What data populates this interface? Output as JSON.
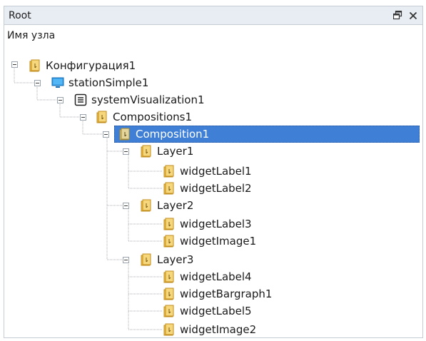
{
  "panel": {
    "title": "Root",
    "column_header": "Имя узла"
  },
  "tree": {
    "nodes": [
      {
        "label": "Конфигурация1",
        "icon": "folder-icon"
      },
      {
        "label": "stationSimple1",
        "icon": "monitor-icon"
      },
      {
        "label": "systemVisualization1",
        "icon": "list-icon"
      },
      {
        "label": "Compositions1",
        "icon": "folder-icon"
      },
      {
        "label": "Composition1",
        "icon": "folder-icon",
        "selected": true
      },
      {
        "label": "Layer1",
        "icon": "folder-icon"
      },
      {
        "label": "widgetLabel1",
        "icon": "document-icon"
      },
      {
        "label": "widgetLabel2",
        "icon": "document-icon"
      },
      {
        "label": "Layer2",
        "icon": "folder-icon"
      },
      {
        "label": "widgetLabel3",
        "icon": "document-icon"
      },
      {
        "label": "widgetImage1",
        "icon": "document-icon"
      },
      {
        "label": "Layer3",
        "icon": "folder-icon"
      },
      {
        "label": "widgetLabel4",
        "icon": "document-icon"
      },
      {
        "label": "widgetBargraph1",
        "icon": "document-icon"
      },
      {
        "label": "widgetLabel5",
        "icon": "document-icon"
      },
      {
        "label": "widgetImage2",
        "icon": "document-icon"
      }
    ]
  },
  "colors": {
    "selection": "#3f80d6",
    "titlebar": "#e8edf4",
    "folder": "#f2c14e"
  }
}
